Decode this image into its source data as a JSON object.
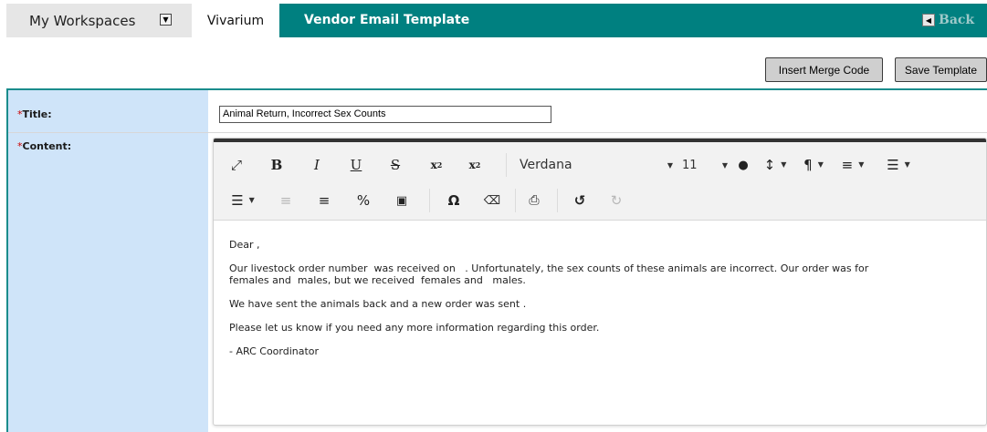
{
  "topbar": {
    "workspaces_label": "My Workspaces",
    "module_tab": "Vivarium",
    "page_title": "Vendor Email Template",
    "back_label": "Back"
  },
  "actions": {
    "insert_merge_code": "Insert Merge Code",
    "save_template": "Save Template"
  },
  "form": {
    "title_label": "Title:",
    "content_label": "Content:",
    "required_marker": "*",
    "title_value": "Animal Return, Incorrect Sex Counts"
  },
  "toolbar": {
    "font_family": "Verdana",
    "font_size": "11",
    "icons": [
      "maximize-icon",
      "bold-icon",
      "italic-icon",
      "underline-icon",
      "strikethrough-icon",
      "subscript-icon",
      "superscript-icon",
      "font-color-icon",
      "line-height-icon",
      "paragraph-format-icon",
      "align-icon",
      "ordered-list-icon",
      "unordered-list-icon",
      "outdent-icon",
      "indent-icon",
      "link-icon",
      "image-icon",
      "special-characters-icon",
      "clear-formatting-icon",
      "print-icon",
      "undo-icon",
      "redo-icon"
    ]
  },
  "content": {
    "paragraphs": [
      "Dear ,",
      "Our livestock order number  was received on   . Unfortunately, the sex counts of these animals are incorrect. Our order was for\nfemales and  males, but we received  females and   males.",
      "We have sent the animals back and a new order was sent .",
      "Please let us know if you need any more information regarding this order.",
      "- ARC Coordinator"
    ]
  },
  "colors": {
    "title_bar": "#008080",
    "label_column": "#cfe4f9",
    "required": "#cc0000"
  }
}
